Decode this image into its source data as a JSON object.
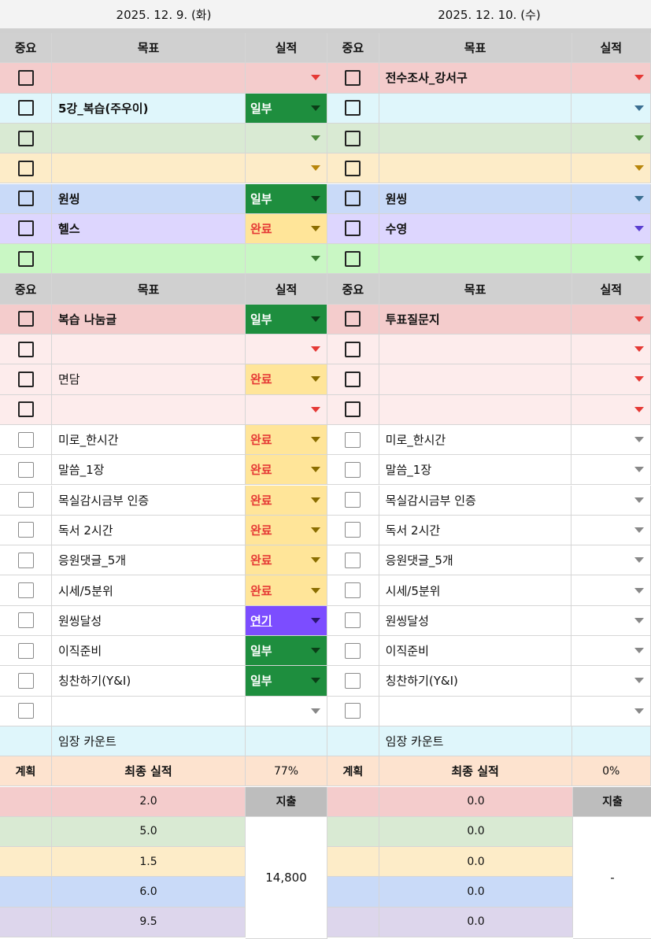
{
  "dates": {
    "left": "2025. 12. 9. (화)",
    "right": "2025. 12. 10. (수)"
  },
  "headers": {
    "importance": "중요",
    "goal": "목표",
    "result": "실적"
  },
  "left": {
    "rows": [
      {
        "goal": "",
        "result": "",
        "bg": "#f4cccc",
        "res_bg": "#f4cccc",
        "tri": "#e53935",
        "cb": "dark",
        "bold": false
      },
      {
        "goal": "5강_복습(주우이)",
        "result": "일부",
        "bg": "#dff6fb",
        "res_bg": "#1e8e3e",
        "res_color": "#ffffff",
        "tri": "#0b3d17",
        "cb": "dark",
        "bold": true
      },
      {
        "goal": "",
        "result": "",
        "bg": "#d9ead3",
        "res_bg": "#d9ead3",
        "tri": "#4b8a3a",
        "cb": "dark",
        "bold": false
      },
      {
        "goal": "",
        "result": "",
        "bg": "#fdecc8",
        "res_bg": "#fdecc8",
        "tri": "#b8860b",
        "cb": "dark",
        "bold": false
      },
      {
        "goal": "원씽",
        "result": "일부",
        "bg": "#c9daf8",
        "res_bg": "#1e8e3e",
        "res_color": "#ffffff",
        "tri": "#0b3d17",
        "cb": "dark",
        "bold": true
      },
      {
        "goal": "헬스",
        "result": "완료",
        "bg": "#ddd6fe",
        "res_bg": "#ffe599",
        "res_color": "#e53935",
        "tri": "#8a6d00",
        "cb": "dark",
        "bold": true
      },
      {
        "goal": "",
        "result": "",
        "bg": "#c9f7c4",
        "res_bg": "#c9f7c4",
        "tri": "#3a7a32",
        "cb": "dark",
        "bold": false
      }
    ],
    "rows2": [
      {
        "goal": "복습 나눔글",
        "result": "일부",
        "bg": "#f4cccc",
        "res_bg": "#1e8e3e",
        "res_color": "#ffffff",
        "tri": "#0b3d17",
        "cb": "dark",
        "bold": true
      },
      {
        "goal": "",
        "result": "",
        "bg": "#fdecec",
        "res_bg": "#fdecec",
        "tri": "#e53935",
        "cb": "dark",
        "bold": false
      },
      {
        "goal": "면담",
        "result": "완료",
        "bg": "#fdecec",
        "res_bg": "#ffe599",
        "res_color": "#e53935",
        "tri": "#8a6d00",
        "cb": "dark",
        "bold": false
      },
      {
        "goal": "",
        "result": "",
        "bg": "#fdecec",
        "res_bg": "#fdecec",
        "tri": "#e53935",
        "cb": "dark",
        "bold": false
      },
      {
        "goal": "미로_한시간",
        "result": "완료",
        "bg": "#ffffff",
        "res_bg": "#ffe599",
        "res_color": "#e53935",
        "tri": "#8a6d00",
        "cb": "light",
        "bold": false
      },
      {
        "goal": "말씀_1장",
        "result": "완료",
        "bg": "#ffffff",
        "res_bg": "#ffe599",
        "res_color": "#e53935",
        "tri": "#8a6d00",
        "cb": "light",
        "bold": false
      },
      {
        "goal": "목실감시금부 인증",
        "result": "완료",
        "bg": "#ffffff",
        "res_bg": "#ffe599",
        "res_color": "#e53935",
        "tri": "#8a6d00",
        "cb": "light",
        "bold": false
      },
      {
        "goal": "독서 2시간",
        "result": "완료",
        "bg": "#ffffff",
        "res_bg": "#ffe599",
        "res_color": "#e53935",
        "tri": "#8a6d00",
        "cb": "light",
        "bold": false
      },
      {
        "goal": "응원댓글_5개",
        "result": "완료",
        "bg": "#ffffff",
        "res_bg": "#ffe599",
        "res_color": "#e53935",
        "tri": "#8a6d00",
        "cb": "light",
        "bold": false
      },
      {
        "goal": "시세/5분위",
        "result": "완료",
        "bg": "#ffffff",
        "res_bg": "#ffe599",
        "res_color": "#e53935",
        "tri": "#8a6d00",
        "cb": "light",
        "bold": false
      },
      {
        "goal": "원씽달성",
        "result": "연기",
        "bg": "#ffffff",
        "res_bg": "#7c4dff",
        "res_color": "#ffffff",
        "tri": "#2a1670",
        "cb": "light",
        "bold": false
      },
      {
        "goal": "이직준비",
        "result": "일부",
        "bg": "#ffffff",
        "res_bg": "#1e8e3e",
        "res_color": "#ffffff",
        "tri": "#0b3d17",
        "cb": "light",
        "bold": false
      },
      {
        "goal": "칭찬하기(Y&I)",
        "result": "일부",
        "bg": "#ffffff",
        "res_bg": "#1e8e3e",
        "res_color": "#ffffff",
        "tri": "#0b3d17",
        "cb": "light",
        "bold": false
      },
      {
        "goal": "",
        "result": "",
        "bg": "#ffffff",
        "res_bg": "#ffffff",
        "tri": "#888888",
        "cb": "light",
        "bold": false
      }
    ],
    "imjang": "임장 카운트",
    "summary": {
      "plan": "계획",
      "final": "최종 실적",
      "pct": "77%",
      "expense_label": "지출",
      "expense": "14,800"
    },
    "scores": [
      {
        "v": "2.0",
        "bg": "#f4cccc"
      },
      {
        "v": "5.0",
        "bg": "#d9ead3"
      },
      {
        "v": "1.5",
        "bg": "#fdecc8"
      },
      {
        "v": "6.0",
        "bg": "#c9daf8"
      },
      {
        "v": "9.5",
        "bg": "#ddd6ec"
      }
    ]
  },
  "right": {
    "rows": [
      {
        "goal": "전수조사_강서구",
        "result": "",
        "bg": "#f4cccc",
        "res_bg": "#f4cccc",
        "tri": "#e53935",
        "cb": "dark",
        "bold": true
      },
      {
        "goal": "",
        "result": "",
        "bg": "#dff6fb",
        "res_bg": "#dff6fb",
        "tri": "#3b6e91",
        "cb": "dark",
        "bold": false
      },
      {
        "goal": "",
        "result": "",
        "bg": "#d9ead3",
        "res_bg": "#d9ead3",
        "tri": "#4b8a3a",
        "cb": "dark",
        "bold": false
      },
      {
        "goal": "",
        "result": "",
        "bg": "#fdecc8",
        "res_bg": "#fdecc8",
        "tri": "#b8860b",
        "cb": "dark",
        "bold": false
      },
      {
        "goal": "원씽",
        "result": "",
        "bg": "#c9daf8",
        "res_bg": "#c9daf8",
        "tri": "#3b6e91",
        "cb": "dark",
        "bold": true
      },
      {
        "goal": "수영",
        "result": "",
        "bg": "#ddd6fe",
        "res_bg": "#ddd6fe",
        "tri": "#5b3fd1",
        "cb": "dark",
        "bold": true
      },
      {
        "goal": "",
        "result": "",
        "bg": "#c9f7c4",
        "res_bg": "#c9f7c4",
        "tri": "#3a7a32",
        "cb": "dark",
        "bold": false
      }
    ],
    "rows2": [
      {
        "goal": "투표질문지",
        "result": "",
        "bg": "#f4cccc",
        "res_bg": "#f4cccc",
        "tri": "#e53935",
        "cb": "dark",
        "bold": true
      },
      {
        "goal": "",
        "result": "",
        "bg": "#fdecec",
        "res_bg": "#fdecec",
        "tri": "#e53935",
        "cb": "dark",
        "bold": false
      },
      {
        "goal": "",
        "result": "",
        "bg": "#fdecec",
        "res_bg": "#fdecec",
        "tri": "#e53935",
        "cb": "dark",
        "bold": false
      },
      {
        "goal": "",
        "result": "",
        "bg": "#fdecec",
        "res_bg": "#fdecec",
        "tri": "#e53935",
        "cb": "dark",
        "bold": false
      },
      {
        "goal": "미로_한시간",
        "result": "",
        "bg": "#ffffff",
        "res_bg": "#ffffff",
        "tri": "#888888",
        "cb": "light",
        "bold": false
      },
      {
        "goal": "말씀_1장",
        "result": "",
        "bg": "#ffffff",
        "res_bg": "#ffffff",
        "tri": "#888888",
        "cb": "light",
        "bold": false
      },
      {
        "goal": "목실감시금부 인증",
        "result": "",
        "bg": "#ffffff",
        "res_bg": "#ffffff",
        "tri": "#888888",
        "cb": "light",
        "bold": false
      },
      {
        "goal": "독서 2시간",
        "result": "",
        "bg": "#ffffff",
        "res_bg": "#ffffff",
        "tri": "#888888",
        "cb": "light",
        "bold": false
      },
      {
        "goal": "응원댓글_5개",
        "result": "",
        "bg": "#ffffff",
        "res_bg": "#ffffff",
        "tri": "#888888",
        "cb": "light",
        "bold": false
      },
      {
        "goal": "시세/5분위",
        "result": "",
        "bg": "#ffffff",
        "res_bg": "#ffffff",
        "tri": "#888888",
        "cb": "light",
        "bold": false
      },
      {
        "goal": "원씽달성",
        "result": "",
        "bg": "#ffffff",
        "res_bg": "#ffffff",
        "tri": "#888888",
        "cb": "light",
        "bold": false
      },
      {
        "goal": "이직준비",
        "result": "",
        "bg": "#ffffff",
        "res_bg": "#ffffff",
        "tri": "#888888",
        "cb": "light",
        "bold": false
      },
      {
        "goal": "칭찬하기(Y&I)",
        "result": "",
        "bg": "#ffffff",
        "res_bg": "#ffffff",
        "tri": "#888888",
        "cb": "light",
        "bold": false
      },
      {
        "goal": "",
        "result": "",
        "bg": "#ffffff",
        "res_bg": "#ffffff",
        "tri": "#888888",
        "cb": "light",
        "bold": false
      }
    ],
    "imjang": "임장 카운트",
    "summary": {
      "plan": "계획",
      "final": "최종 실적",
      "pct": "0%",
      "expense_label": "지출",
      "expense": "-"
    },
    "scores": [
      {
        "v": "0.0",
        "bg": "#f4cccc"
      },
      {
        "v": "0.0",
        "bg": "#d9ead3"
      },
      {
        "v": "0.0",
        "bg": "#fdecc8"
      },
      {
        "v": "0.0",
        "bg": "#c9daf8"
      },
      {
        "v": "0.0",
        "bg": "#ddd6ec"
      }
    ]
  },
  "colors": {
    "header_gray": "#d0d0d0",
    "summary_bg": "#fde3cf",
    "imjang_bg": "#dff6fb",
    "expense_label_bg": "#bdbdbd"
  }
}
